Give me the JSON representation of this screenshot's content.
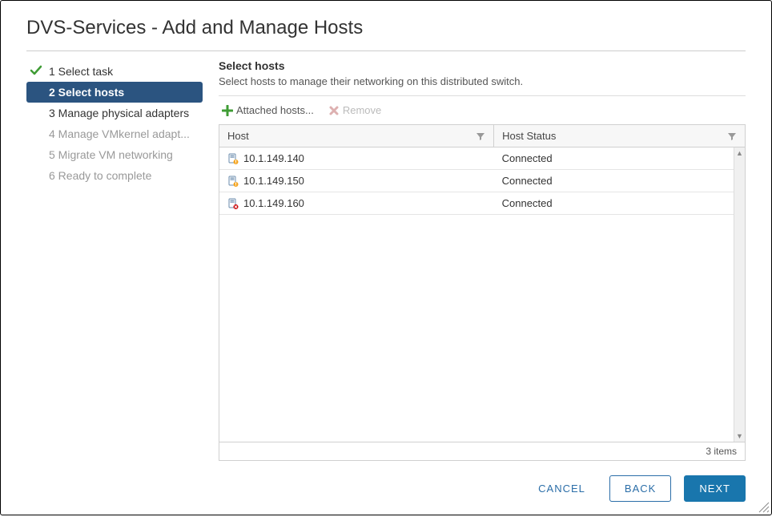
{
  "title": "DVS-Services - Add and Manage Hosts",
  "nav": {
    "items": [
      {
        "num": "1",
        "label": "Select task",
        "state": "completed"
      },
      {
        "num": "2",
        "label": "Select hosts",
        "state": "active"
      },
      {
        "num": "3",
        "label": "Manage physical adapters",
        "state": "pending-dark"
      },
      {
        "num": "4",
        "label": "Manage VMkernel adapt...",
        "state": "pending"
      },
      {
        "num": "5",
        "label": "Migrate VM networking",
        "state": "pending"
      },
      {
        "num": "6",
        "label": "Ready to complete",
        "state": "pending"
      }
    ]
  },
  "panel": {
    "heading": "Select hosts",
    "description": "Select hosts to manage their networking on this distributed switch."
  },
  "toolbar": {
    "attached_label": "Attached hosts...",
    "remove_label": "Remove"
  },
  "grid": {
    "columns": {
      "host": "Host",
      "status": "Host Status"
    },
    "rows": [
      {
        "host": "10.1.149.140",
        "status": "Connected",
        "badge": "warning"
      },
      {
        "host": "10.1.149.150",
        "status": "Connected",
        "badge": "warning"
      },
      {
        "host": "10.1.149.160",
        "status": "Connected",
        "badge": "error"
      }
    ],
    "footer": "3 items"
  },
  "footer": {
    "cancel": "CANCEL",
    "back": "BACK",
    "next": "NEXT"
  }
}
